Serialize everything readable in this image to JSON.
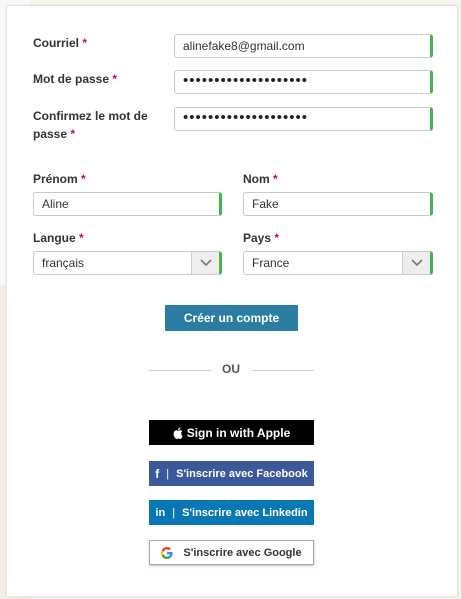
{
  "form": {
    "email": {
      "label": "Courriel",
      "value": "alinefake8@gmail.com"
    },
    "password": {
      "label": "Mot de passe",
      "value": "••••••••••••••••••••"
    },
    "confirm": {
      "label_line1": "Confirmez le mot de",
      "label_line2": "passe",
      "value": "••••••••••••••••••••"
    },
    "firstname": {
      "label": "Prénom",
      "value": "Aline"
    },
    "lastname": {
      "label": "Nom",
      "value": "Fake"
    },
    "language": {
      "label": "Langue",
      "value": "français"
    },
    "country": {
      "label": "Pays",
      "value": "France"
    },
    "required_mark": "*",
    "submit_label": "Créer un compte"
  },
  "divider": {
    "label": "OU"
  },
  "social": {
    "apple": "Sign in with Apple",
    "facebook": "S'inscrire avec Facebook",
    "linkedin": "S'inscrire avec Linkedin",
    "google": "S'inscrire avec Google",
    "separator": "|"
  },
  "colors": {
    "primary": "#2b7ea1",
    "valid": "#46b450",
    "required": "#c8102e",
    "facebook": "#3b5998",
    "linkedin": "#0a77b5"
  }
}
